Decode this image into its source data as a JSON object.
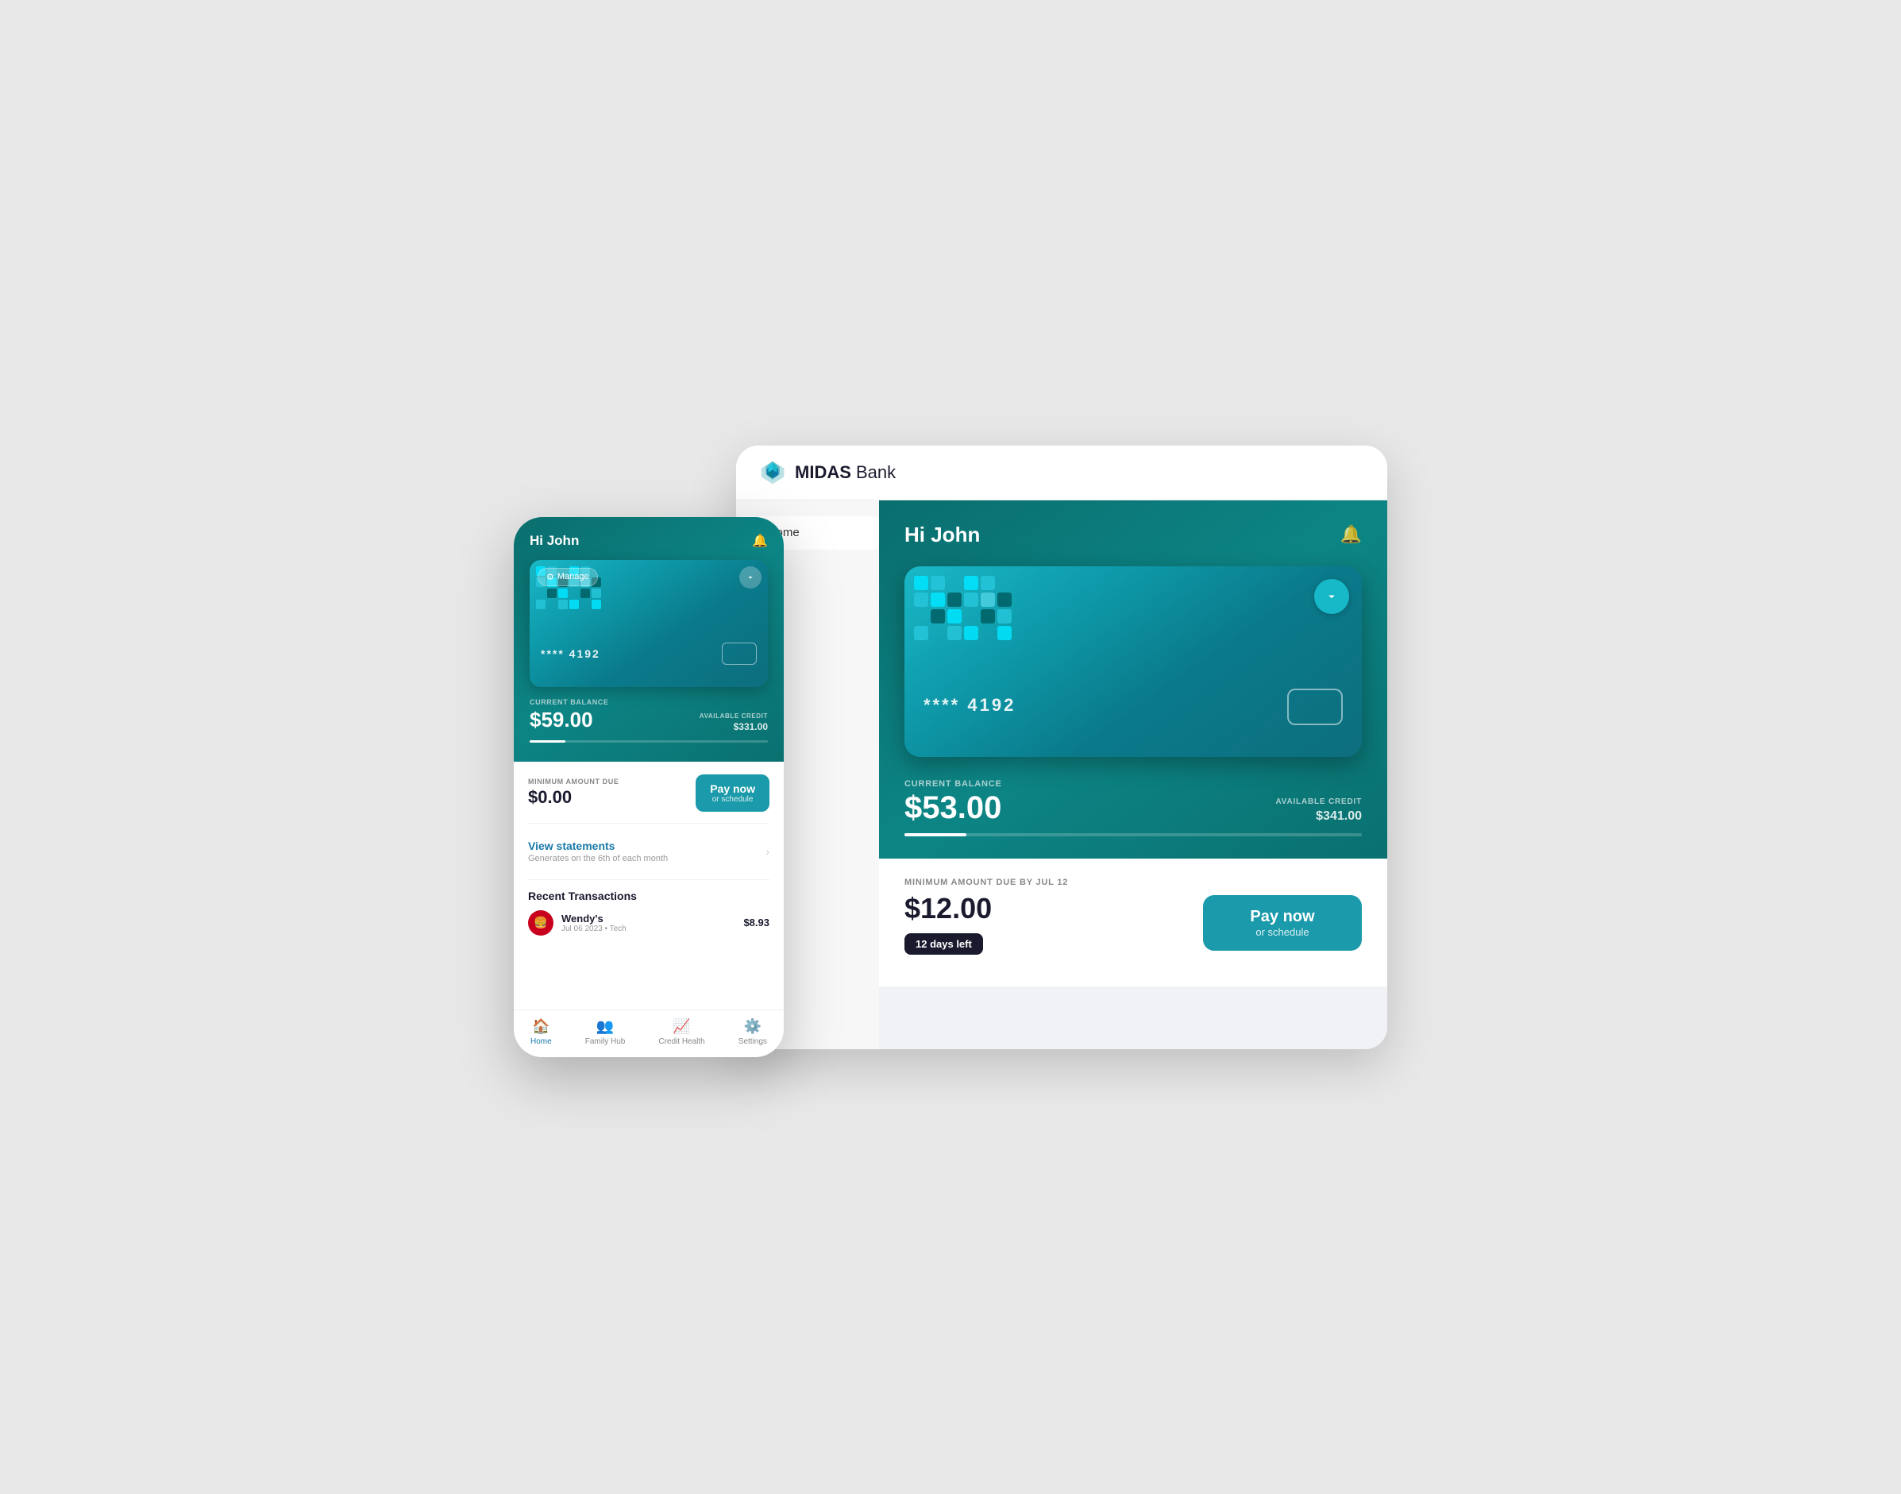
{
  "app": {
    "name": "MIDAS",
    "name_suffix": " Bank",
    "logo_icon": "diamond"
  },
  "desktop": {
    "sidebar": {
      "items": [
        {
          "label": "Home",
          "icon": "home",
          "active": true
        }
      ]
    },
    "main": {
      "greeting": "Hi John",
      "card": {
        "number_masked": "**** 4192"
      },
      "balance": {
        "current_label": "CURRENT BALANCE",
        "current_amount": "$53.00",
        "available_label": "AVAILABLE CREDIT",
        "available_amount": "$341.00",
        "progress_percent": 13.5
      },
      "payment": {
        "minimum_label": "MINIMUM AMOUNT DUE BY JUL 12",
        "minimum_amount": "$12.00",
        "days_left_label": "12 days left",
        "pay_now_line1": "Pay now",
        "pay_now_line2": "or schedule"
      }
    }
  },
  "mobile": {
    "greeting": "Hi John",
    "card": {
      "manage_label": "Manage",
      "number_masked": "**** 4192"
    },
    "balance": {
      "current_label": "CURRENT BALANCE",
      "current_amount": "$59.00",
      "available_label": "AVAILABLE CREDIT",
      "available_amount": "$331.00"
    },
    "payment": {
      "minimum_label": "MINIMUM AMOUNT DUE",
      "minimum_amount": "$0.00",
      "pay_now_line1": "Pay now",
      "pay_now_line2": "or schedule"
    },
    "statements": {
      "title": "View statements",
      "subtitle": "Generates on the 6th of each month"
    },
    "recent_transactions": {
      "title": "Recent Transactions",
      "items": [
        {
          "merchant": "Wendy's",
          "details": "Jul 06 2023 • Tech",
          "amount": "$8.93",
          "color": "#c00",
          "icon": "🍔"
        }
      ]
    },
    "nav": [
      {
        "label": "Home",
        "icon": "🏠",
        "active": true
      },
      {
        "label": "Family Hub",
        "icon": "👥",
        "active": false
      },
      {
        "label": "Credit Health",
        "icon": "📈",
        "active": false
      },
      {
        "label": "Settings",
        "icon": "⚙️",
        "active": false
      }
    ]
  }
}
